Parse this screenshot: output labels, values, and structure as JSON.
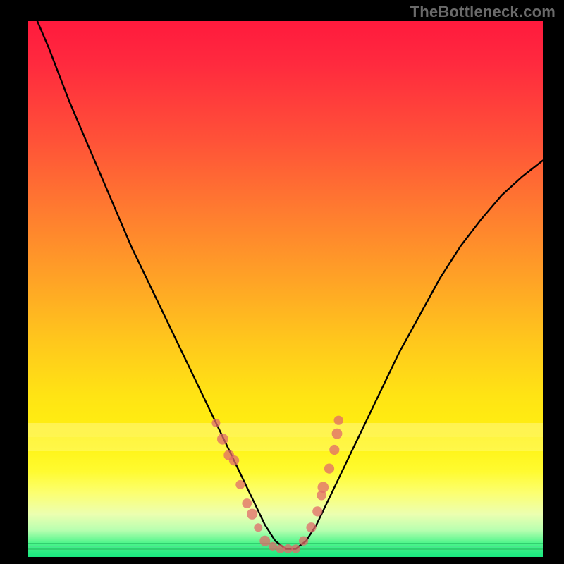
{
  "watermark": "TheBottleneck.com",
  "colors": {
    "frame_bg": "#000000",
    "curve_stroke": "#000000",
    "dot_fill": "#e06a6a",
    "dot_stroke": "#c85a5a"
  },
  "chart_data": {
    "type": "line",
    "title": "",
    "xlabel": "",
    "ylabel": "",
    "xlim": [
      0,
      100
    ],
    "ylim": [
      0,
      100
    ],
    "grid": false,
    "legend": false,
    "series": [
      {
        "name": "bottleneck-curve",
        "x": [
          0,
          4,
          8,
          12,
          16,
          20,
          24,
          28,
          32,
          34,
          36,
          38,
          40,
          42,
          44,
          46,
          48,
          50,
          52,
          54,
          56,
          58,
          60,
          64,
          68,
          72,
          76,
          80,
          84,
          88,
          92,
          96,
          100
        ],
        "y": [
          104,
          95,
          85,
          76,
          67,
          58,
          50,
          42,
          34,
          30,
          26,
          22,
          18,
          14,
          10,
          6,
          3,
          1.5,
          1.5,
          3,
          6,
          10,
          14,
          22,
          30,
          38,
          45,
          52,
          58,
          63,
          67.5,
          71,
          74
        ]
      }
    ],
    "points": {
      "name": "dots",
      "x": [
        36.5,
        37.8,
        39.0,
        40.0,
        41.2,
        42.5,
        43.5,
        44.7,
        46.0,
        47.5,
        49.0,
        50.5,
        52.0,
        53.5,
        55.0,
        56.2,
        57.0,
        57.3,
        58.5,
        59.5,
        60.0,
        60.3
      ],
      "y": [
        25.0,
        22.0,
        19.0,
        18.0,
        13.5,
        10.0,
        8.0,
        5.5,
        3.0,
        2.0,
        1.5,
        1.5,
        1.5,
        3.0,
        5.5,
        8.5,
        11.5,
        13.0,
        16.5,
        20.0,
        23.0,
        25.5
      ]
    },
    "gradient_stops": [
      {
        "pos": 0,
        "color": "#ff1a3d"
      },
      {
        "pos": 0.22,
        "color": "#ff5138"
      },
      {
        "pos": 0.48,
        "color": "#ffa226"
      },
      {
        "pos": 0.7,
        "color": "#ffe414"
      },
      {
        "pos": 0.84,
        "color": "#fffb30"
      },
      {
        "pos": 0.92,
        "color": "#ecffb0"
      },
      {
        "pos": 0.975,
        "color": "#4cf58a"
      },
      {
        "pos": 1.0,
        "color": "#18e880"
      }
    ]
  }
}
